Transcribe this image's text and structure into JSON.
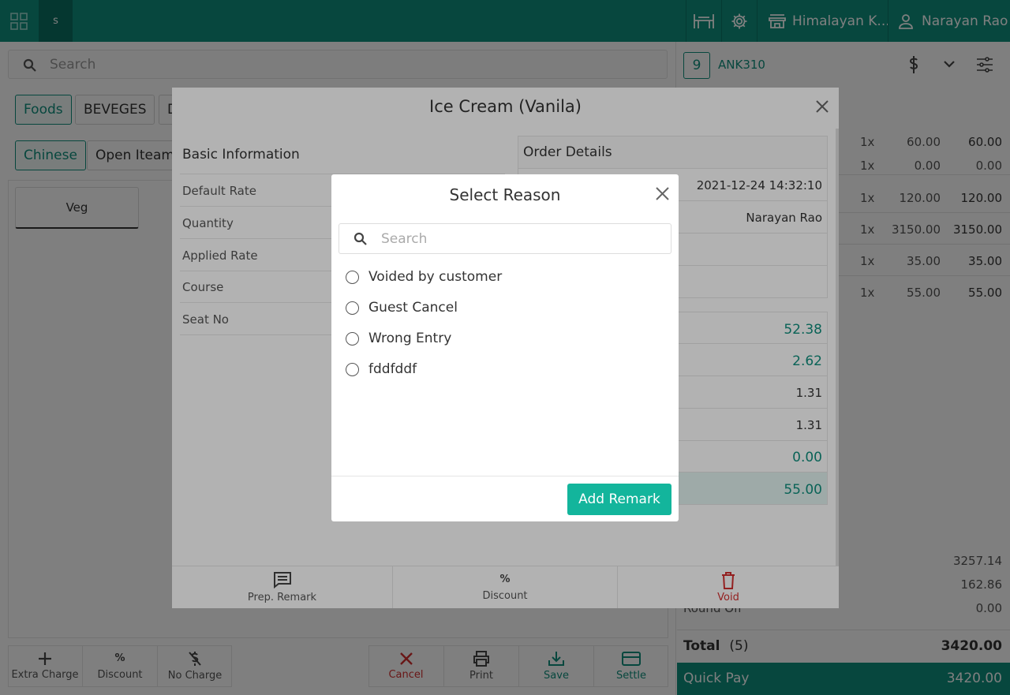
{
  "topbar": {
    "app_badge": "s",
    "outlet": "Himalayan K...",
    "user": "Narayan Rao"
  },
  "left": {
    "search_placeholder": "Search",
    "categories": [
      "Foods",
      "BEVEGES",
      "D"
    ],
    "subcategories": [
      "Chinese",
      "Open Iteam"
    ],
    "item_card": "Veg",
    "bottom_buttons": [
      "Extra Charge",
      "Discount",
      "No Charge"
    ],
    "action_buttons": [
      "Cancel",
      "Print",
      "Save",
      "Settle"
    ]
  },
  "right": {
    "table_no": "9",
    "order_code": "ANK310",
    "items": [
      {
        "qty": "1x",
        "price": "60.00",
        "amount": "60.00"
      },
      {
        "qty": "1x",
        "price": "0.00",
        "amount": "0.00"
      },
      {
        "qty": "1x",
        "price": "120.00",
        "amount": "120.00"
      },
      {
        "qty": "1x",
        "price": "3150.00",
        "amount": "3150.00"
      },
      {
        "qty": "1x",
        "price": "35.00",
        "amount": "35.00"
      },
      {
        "qty": "1x",
        "price": "55.00",
        "amount": "55.00"
      }
    ],
    "subtotals": [
      "3257.14",
      "162.86",
      "0.00"
    ],
    "round_off_label": "Round Off",
    "total_label": "Total",
    "total_count": "(5)",
    "total_value": "3420.00",
    "quick_pay_label": "Quick Pay",
    "quick_pay_value": "3420.00"
  },
  "item_modal": {
    "title": "Ice Cream (Vanila)",
    "basic_info_heading": "Basic Information",
    "basic_fields": [
      "Default Rate",
      "Quantity",
      "Applied Rate",
      "Course",
      "Seat No"
    ],
    "order_details_heading": "Order Details",
    "order_date": "2021-12-24 14:32:10",
    "order_user": "Narayan Rao",
    "summary_values": [
      "52.38",
      "2.62",
      "1.31",
      "1.31",
      "0.00",
      "55.00"
    ],
    "footer_buttons": [
      "Prep. Remark",
      "Discount",
      "Void"
    ]
  },
  "reason_modal": {
    "title": "Select Reason",
    "search_placeholder": "Search",
    "options": [
      "Voided by customer",
      "Guest Cancel",
      "Wrong Entry",
      "fddfddf"
    ],
    "add_remark_label": "Add Remark"
  },
  "colors": {
    "primary": "#0f8f7d",
    "accent_button": "#13b59c",
    "danger": "#d32f2f"
  }
}
